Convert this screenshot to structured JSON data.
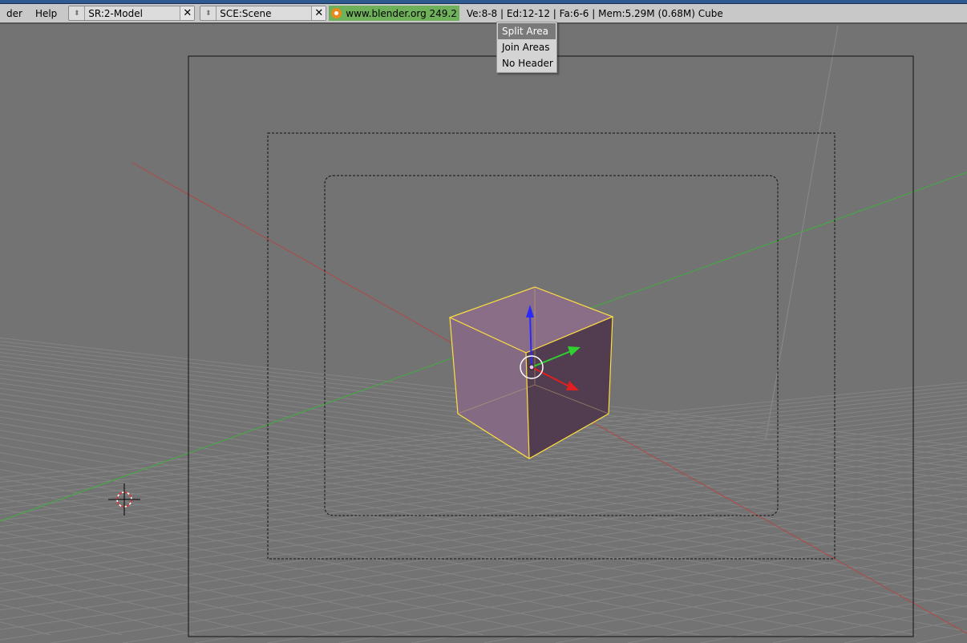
{
  "header": {
    "menus": [
      "der",
      "Help"
    ],
    "screen_field": "SR:2-Model",
    "scene_field": "SCE:Scene",
    "version_link": "www.blender.org 249.2",
    "stats": "Ve:8-8 | Ed:12-12 | Fa:6-6 | Mem:5.29M (0.68M) Cube"
  },
  "context_menu": {
    "items": [
      "Split Area",
      "Join Areas",
      "No Header"
    ],
    "highlighted": 0
  },
  "colors": {
    "viewport": "#737373",
    "header": "#c8c8c8",
    "x_axis": "#b04040",
    "y_axis": "#40a040",
    "selection": "#ffe040"
  }
}
